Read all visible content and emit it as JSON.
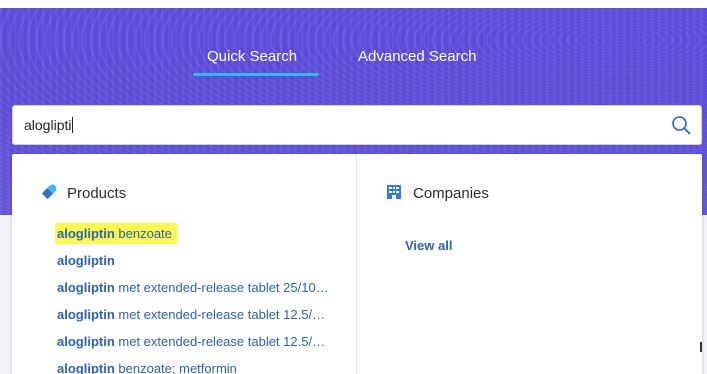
{
  "tabs": {
    "quick": "Quick Search",
    "advanced": "Advanced Search",
    "active": "Quick Search"
  },
  "search": {
    "value": "aloglipti"
  },
  "products": {
    "title": "Products",
    "icon": "pill-icon",
    "items": [
      {
        "match": "alogliptin",
        "rest": " benzoate",
        "highlighted": true
      },
      {
        "match": "alogliptin",
        "rest": ""
      },
      {
        "match": "alogliptin",
        "rest": " met extended-release tablet 25/10…"
      },
      {
        "match": "alogliptin",
        "rest": " met extended-release tablet 12.5/…"
      },
      {
        "match": "alogliptin",
        "rest": " met extended-release tablet 12.5/…"
      },
      {
        "match": "alogliptin",
        "rest": " benzoate; metformin"
      }
    ]
  },
  "companies": {
    "title": "Companies",
    "icon": "building-icon",
    "view_all": "View all"
  },
  "colors": {
    "hero": "#5b49d9",
    "accent_underline": "#2dbbf2",
    "link": "#2b62b4",
    "highlight": "#fafa4e"
  }
}
